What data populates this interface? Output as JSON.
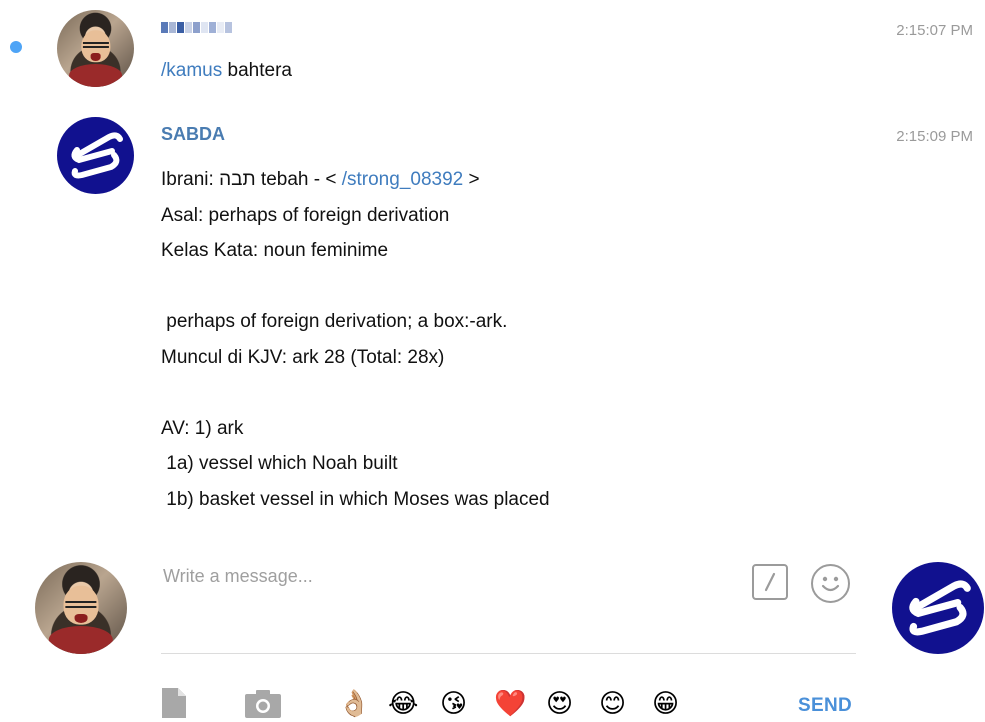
{
  "messages": [
    {
      "sender_obscured": true,
      "time": "2:15:07 PM",
      "command": "/kamus",
      "argument": " bahtera",
      "unread": true
    },
    {
      "sender": "SABDA",
      "time": "2:15:09 PM",
      "line1": {
        "prefix": "Ibrani: תבה tebah - < ",
        "link": "/strong_08392",
        "suffix": " >"
      },
      "lines": [
        "Asal: perhaps of foreign derivation",
        "Kelas Kata: noun feminime",
        "",
        " perhaps of foreign derivation; a box:-ark.",
        "Muncul di KJV: ark 28 (Total: 28x)",
        "",
        "AV: 1) ark",
        " 1a) vessel which Noah built",
        " 1b) basket vessel in which Moses was placed"
      ]
    }
  ],
  "composer": {
    "placeholder": "Write a message...",
    "slash_icon": "slash-command-icon",
    "emoji_icon": "smiley-icon",
    "send_label": "SEND",
    "attach_icon": "file-icon",
    "camera_icon": "camera-icon",
    "quick_emojis": [
      "👌🏼",
      "😂",
      "😘",
      "❤️",
      "😍",
      "😊",
      "😁"
    ]
  },
  "colors": {
    "accent": "#4a7cb1",
    "link": "#3f7cbe",
    "sabda_avatar": "#11118f",
    "unread_dot": "#4ea4f6",
    "send": "#4a90d9"
  }
}
